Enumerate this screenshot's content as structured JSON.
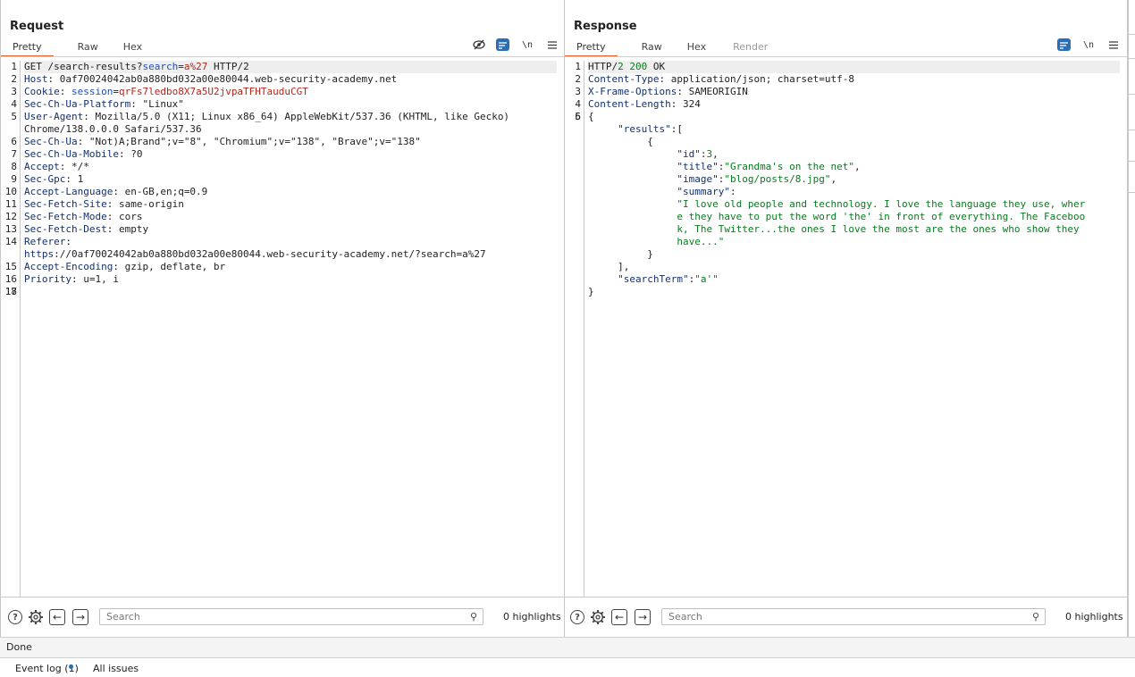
{
  "request": {
    "title": "Request",
    "tabs": [
      "Pretty",
      "Raw",
      "Hex"
    ],
    "active_tab": "Pretty",
    "tools": {
      "wrap_label": "\\n"
    },
    "lines": [
      {
        "n": "1",
        "text": "GET /search-results?search=a%27 HTTP/2"
      },
      {
        "n": "2",
        "text": "Host: 0af70024042ab0a880bd032a00e80044.web-security-academy.net"
      },
      {
        "n": "3",
        "text": "Cookie: session=qrFs7ledbo8X7a5U2jvpaTFHTauduCGT"
      },
      {
        "n": "4",
        "text": "Sec-Ch-Ua-Platform: \"Linux\""
      },
      {
        "n": "5",
        "text": "User-Agent: Mozilla/5.0 (X11; Linux x86_64) AppleWebKit/537.36 (KHTML, like Gecko)"
      },
      {
        "n": "",
        "text": "Chrome/138.0.0.0 Safari/537.36"
      },
      {
        "n": "6",
        "text": "Sec-Ch-Ua: \"Not)A;Brand\";v=\"8\", \"Chromium\";v=\"138\", \"Brave\";v=\"138\""
      },
      {
        "n": "7",
        "text": "Sec-Ch-Ua-Mobile: ?0"
      },
      {
        "n": "8",
        "text": "Accept: */*"
      },
      {
        "n": "9",
        "text": "Sec-Gpc: 1"
      },
      {
        "n": "10",
        "text": "Accept-Language: en-GB,en;q=0.9"
      },
      {
        "n": "11",
        "text": "Sec-Fetch-Site: same-origin"
      },
      {
        "n": "12",
        "text": "Sec-Fetch-Mode: cors"
      },
      {
        "n": "13",
        "text": "Sec-Fetch-Dest: empty"
      },
      {
        "n": "14",
        "text": "Referer:"
      },
      {
        "n": "",
        "text": "https://0af70024042ab0a880bd032a00e80044.web-security-academy.net/?search=a%27"
      },
      {
        "n": "15",
        "text": "Accept-Encoding: gzip, deflate, br"
      },
      {
        "n": "16",
        "text": "Priority: u=1, i"
      },
      {
        "n": "17",
        "text": ""
      },
      {
        "n": "18",
        "text": ""
      }
    ],
    "search_placeholder": "Search",
    "highlights": "0 highlights"
  },
  "response": {
    "title": "Response",
    "tabs": [
      "Pretty",
      "Raw",
      "Hex",
      "Render"
    ],
    "active_tab": "Pretty",
    "tools": {
      "wrap_label": "\\n"
    },
    "lines": [
      {
        "n": "1",
        "text": "HTTP/2 200 OK"
      },
      {
        "n": "2",
        "text": "Content-Type: application/json; charset=utf-8"
      },
      {
        "n": "3",
        "text": "X-Frame-Options: SAMEORIGIN"
      },
      {
        "n": "4",
        "text": "Content-Length: 324"
      },
      {
        "n": "5",
        "text": ""
      },
      {
        "n": "6",
        "text": "{"
      },
      {
        "n": "",
        "text": "     \"results\":["
      },
      {
        "n": "",
        "text": "          {"
      },
      {
        "n": "",
        "text": "               \"id\":3,"
      },
      {
        "n": "",
        "text": "               \"title\":\"Grandma's on the net\","
      },
      {
        "n": "",
        "text": "               \"image\":\"blog/posts/8.jpg\","
      },
      {
        "n": "",
        "text": "               \"summary\":"
      },
      {
        "n": "",
        "text": "               \"I love old people and technology. I love the language they use, wher"
      },
      {
        "n": "",
        "text": "               e they have to put the word 'the' in front of everything. The Faceboo"
      },
      {
        "n": "",
        "text": "               k, The Twitter...the ones I love the most are the ones who show they"
      },
      {
        "n": "",
        "text": "               have...\""
      },
      {
        "n": "",
        "text": "          }"
      },
      {
        "n": "",
        "text": "     ],"
      },
      {
        "n": "",
        "text": "     \"searchTerm\":\"a'\""
      },
      {
        "n": "",
        "text": "}"
      }
    ],
    "search_placeholder": "Search",
    "highlights": "0 highlights"
  },
  "status": {
    "text": "Done"
  },
  "footer": {
    "event_log": "Event log (1)",
    "all_issues": "All issues"
  },
  "colors": {
    "accent": "#e0662d",
    "blue": "#2a6fb5",
    "header_key": "#14306b",
    "cookie_value": "#b4261c",
    "json_value": "#0a7a1f"
  }
}
